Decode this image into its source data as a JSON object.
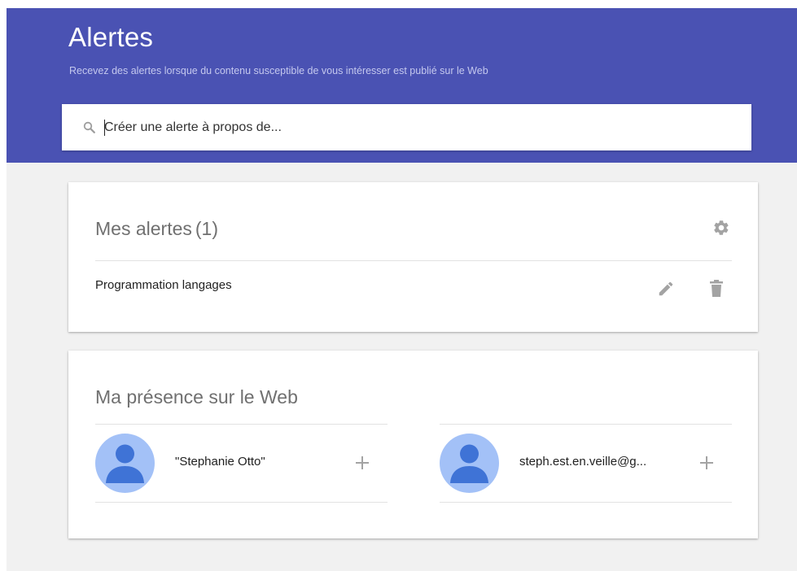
{
  "header": {
    "title": "Alertes",
    "subtitle": "Recevez des alertes lorsque du contenu susceptible de vous intéresser est publié sur le Web"
  },
  "search": {
    "placeholder": "Créer une alerte à propos de...",
    "icon": "search-icon"
  },
  "my_alerts": {
    "title": "Mes alertes",
    "count": "(1)",
    "settings_icon": "gear-icon",
    "items": [
      {
        "label": "Programmation langages",
        "edit_icon": "pencil-icon",
        "delete_icon": "trash-icon"
      }
    ]
  },
  "web_presence": {
    "title": "Ma présence sur le Web",
    "items": [
      {
        "label": "\"Stephanie Otto\"",
        "avatar_icon": "person-avatar-icon",
        "add_icon": "plus-icon"
      },
      {
        "label": "steph.est.en.veille@g...",
        "avatar_icon": "person-avatar-icon",
        "add_icon": "plus-icon"
      }
    ]
  },
  "colors": {
    "header_bg": "#4a52b3",
    "page_bg": "#f1f1f1",
    "card_bg": "#ffffff",
    "avatar_bg": "#a3c1f7",
    "avatar_figure": "#3f73d6",
    "icon_gray": "#a3a3a3"
  }
}
